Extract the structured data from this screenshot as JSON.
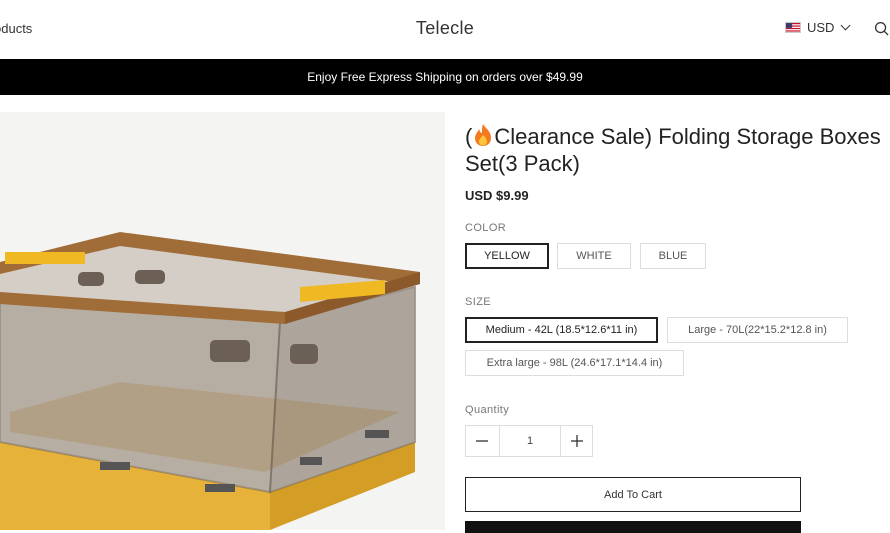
{
  "header": {
    "nav_products": "oducts",
    "brand": "Telecle",
    "currency": "USD"
  },
  "banner": {
    "text": "Enjoy Free Express Shipping on orders over $49.99"
  },
  "product": {
    "title_prefix": "(",
    "title_rest": "Clearance Sale)  Folding Storage Boxes Set(3 Pack)",
    "price": "USD $9.99",
    "color_label": "COLOR",
    "colors": [
      "YELLOW",
      "WHITE",
      "BLUE"
    ],
    "size_label": "SIZE",
    "sizes": [
      "Medium - 42L (18.5*12.6*11 in)",
      "Large - 70L(22*15.2*12.8 in)",
      "Extra large - 98L (24.6*17.1*14.4 in)"
    ],
    "quantity_label": "Quantity",
    "quantity": "1",
    "add_to_cart": "Add To Cart"
  },
  "colors": {
    "banner_bg": "#000000",
    "box_yellow": "#e8b43a",
    "box_wood": "#a0703c"
  }
}
